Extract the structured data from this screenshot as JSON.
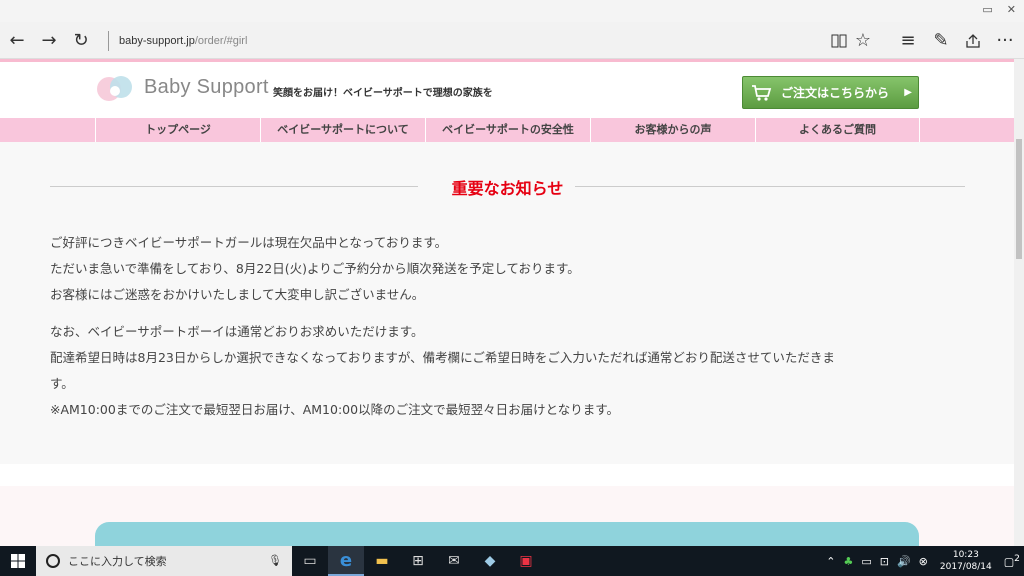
{
  "browser": {
    "url_domain": "baby-support.jp",
    "url_path": "/order/#girl"
  },
  "header": {
    "brand": "Baby Support",
    "tagline": "笑顔をお届け！ベイビーサポートで理想の家族を",
    "order_button": "ご注文はこちらから"
  },
  "nav": [
    {
      "label": "トップページ"
    },
    {
      "label": "ベイビーサポートについて"
    },
    {
      "label": "ベイビーサポートの安全性"
    },
    {
      "label": "お客様からの声"
    },
    {
      "label": "よくあるご質問"
    }
  ],
  "notice": {
    "heading": "重要なお知らせ",
    "para1": [
      "ご好評につきベイビーサポートガールは現在欠品中となっております。",
      "ただいま急いで準備をしており、8月22日(火)よりご予約分から順次発送を予定しております。",
      "お客様にはご迷惑をおかけいたしまして大変申し訳ございません。"
    ],
    "para2": [
      "なお、ベイビーサポートボーイは通常どおりお求めいただけます。",
      "配達希望日時は8月23日からしか選択できなくなっておりますが、備考欄にご希望日時をご入力いただれば通常どおり配送させていただきま",
      "す。",
      "※AM10:00までのご注文で最短翌日お届け、AM10:00以降のご注文で最短翌々日お届けとなります。"
    ]
  },
  "taskbar": {
    "search_placeholder": "ここに入力して検索",
    "time": "10:23",
    "date": "2017/08/14",
    "notifications": "2"
  },
  "colors": {
    "accent_pink": "#f9c6dc",
    "heading_red": "#e60012",
    "order_green": "#6aaa4f"
  }
}
